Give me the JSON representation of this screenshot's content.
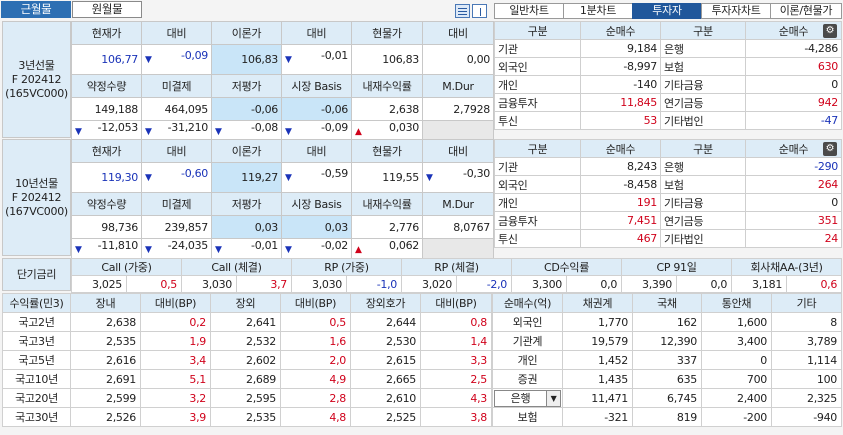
{
  "top_tabs": [
    "근월물",
    "원월물"
  ],
  "chart_tabs": [
    "일반차트",
    "1분차트",
    "투자자",
    "투자자차트",
    "이론/현물가"
  ],
  "futures": [
    {
      "name_lines": [
        "3년선물",
        "F 202412",
        "(165VC000)"
      ],
      "h1": [
        "현재가",
        "대비",
        "이론가",
        "대비",
        "현물가",
        "대비"
      ],
      "r1": [
        {
          "v": "106,77",
          "c": "dn"
        },
        {
          "v": "-0,09",
          "c": "dn",
          "a": "▼"
        },
        {
          "v": "106,83"
        },
        {
          "v": "-0,01",
          "a": "▼"
        },
        {
          "v": "106,83"
        },
        {
          "v": "0,00"
        }
      ],
      "h2": [
        "약정수량",
        "미결제",
        "저평가",
        "시장 Basis",
        "내재수익률",
        "M.Dur"
      ],
      "r2": [
        {
          "v": "149,188"
        },
        {
          "v": "464,095"
        },
        {
          "v": "-0,06"
        },
        {
          "v": "-0,06"
        },
        {
          "v": "2,638"
        },
        {
          "v": "2,7928"
        }
      ],
      "r3": [
        {
          "v": "-12,053",
          "a": "▼"
        },
        {
          "v": "-31,210",
          "a": "▼"
        },
        {
          "v": "-0,08",
          "a": "▼"
        },
        {
          "v": "-0,09",
          "a": "▼"
        },
        {
          "v": "0,030",
          "a": "▲"
        },
        {
          "v": ""
        }
      ],
      "inv_head": [
        "구분",
        "순매수",
        "구분",
        "순매수"
      ],
      "inv": [
        [
          "기관",
          "9,184",
          "은행",
          "-4,286"
        ],
        [
          "외국인",
          "-8,997",
          "보험",
          "630"
        ],
        [
          "개인",
          "-140",
          "기타금융",
          "0"
        ],
        [
          "금융투자",
          "11,845",
          "연기금등",
          "942"
        ],
        [
          "투신",
          "53",
          "기타법인",
          "-47"
        ]
      ]
    },
    {
      "name_lines": [
        "10년선물",
        "F 202412",
        "(167VC000)"
      ],
      "h1": [
        "현재가",
        "대비",
        "이론가",
        "대비",
        "현물가",
        "대비"
      ],
      "r1": [
        {
          "v": "119,30",
          "c": "dn"
        },
        {
          "v": "-0,60",
          "c": "dn",
          "a": "▼"
        },
        {
          "v": "119,27"
        },
        {
          "v": "-0,59",
          "a": "▼"
        },
        {
          "v": "119,55"
        },
        {
          "v": "-0,30",
          "a": "▼"
        }
      ],
      "h2": [
        "약정수량",
        "미결제",
        "저평가",
        "시장 Basis",
        "내재수익률",
        "M.Dur"
      ],
      "r2": [
        {
          "v": "98,736"
        },
        {
          "v": "239,857"
        },
        {
          "v": "0,03"
        },
        {
          "v": "0,03"
        },
        {
          "v": "2,776"
        },
        {
          "v": "8,0767"
        }
      ],
      "r3": [
        {
          "v": "-11,810",
          "a": "▼"
        },
        {
          "v": "-24,035",
          "a": "▼"
        },
        {
          "v": "-0,01",
          "a": "▼"
        },
        {
          "v": "-0,02",
          "a": "▼"
        },
        {
          "v": "0,062",
          "a": "▲"
        },
        {
          "v": ""
        }
      ],
      "inv_head": [
        "구분",
        "순매수",
        "구분",
        "순매수"
      ],
      "inv": [
        [
          "기관",
          "8,243",
          "은행",
          "-290"
        ],
        [
          "외국인",
          "-8,458",
          "보험",
          "264"
        ],
        [
          "개인",
          "191",
          "기타금융",
          "0"
        ],
        [
          "금융투자",
          "7,451",
          "연기금등",
          "351"
        ],
        [
          "투신",
          "467",
          "기타법인",
          "24"
        ]
      ]
    }
  ],
  "short_rates": {
    "label": "단기금리",
    "heads": [
      "Call (가중)",
      "Call (체결)",
      "RP (가중)",
      "RP (체결)",
      "CD수익률",
      "CP 91일",
      "회사채AA-(3년)"
    ],
    "vals": [
      [
        "3,025",
        "0,5"
      ],
      [
        "3,030",
        "3,7"
      ],
      [
        "3,030",
        "-1,0"
      ],
      [
        "3,020",
        "-2,0"
      ],
      [
        "3,300",
        "0,0"
      ],
      [
        "3,390",
        "0,0"
      ],
      [
        "3,181",
        "0,6"
      ]
    ]
  },
  "yield_table": {
    "heads": [
      "수익률(민3)",
      "장내",
      "대비(BP)",
      "장외",
      "대비(BP)",
      "장외호가",
      "대비(BP)"
    ],
    "rows": [
      [
        "국고2년",
        "2,638",
        "0,2",
        "2,641",
        "0,5",
        "2,644",
        "0,8"
      ],
      [
        "국고3년",
        "2,535",
        "1,9",
        "2,532",
        "1,6",
        "2,530",
        "1,4"
      ],
      [
        "국고5년",
        "2,616",
        "3,4",
        "2,602",
        "2,0",
        "2,615",
        "3,3"
      ],
      [
        "국고10년",
        "2,691",
        "5,1",
        "2,689",
        "4,9",
        "2,665",
        "2,5"
      ],
      [
        "국고20년",
        "2,599",
        "3,2",
        "2,595",
        "2,8",
        "2,610",
        "4,3"
      ],
      [
        "국고30년",
        "2,526",
        "3,9",
        "2,535",
        "4,8",
        "2,525",
        "3,8"
      ]
    ]
  },
  "net_buy_table": {
    "heads": [
      "순매수(억)",
      "채권계",
      "국채",
      "통안채",
      "기타"
    ],
    "rows": [
      [
        "외국인",
        "1,770",
        "162",
        "1,600",
        "8"
      ],
      [
        "기관계",
        "19,579",
        "12,390",
        "3,400",
        "3,789"
      ],
      [
        "개인",
        "1,452",
        "337",
        "0",
        "1,114"
      ],
      [
        "증권",
        "1,435",
        "635",
        "700",
        "100"
      ],
      [
        "은행",
        "11,471",
        "6,745",
        "2,400",
        "2,325"
      ],
      [
        "보험",
        "-321",
        "819",
        "-200",
        "-940"
      ]
    ]
  },
  "icons": {
    "settings": "gear-icon",
    "dropdown": "chevron-down-icon",
    "up": "triangle-up-icon",
    "down": "triangle-down-icon"
  }
}
